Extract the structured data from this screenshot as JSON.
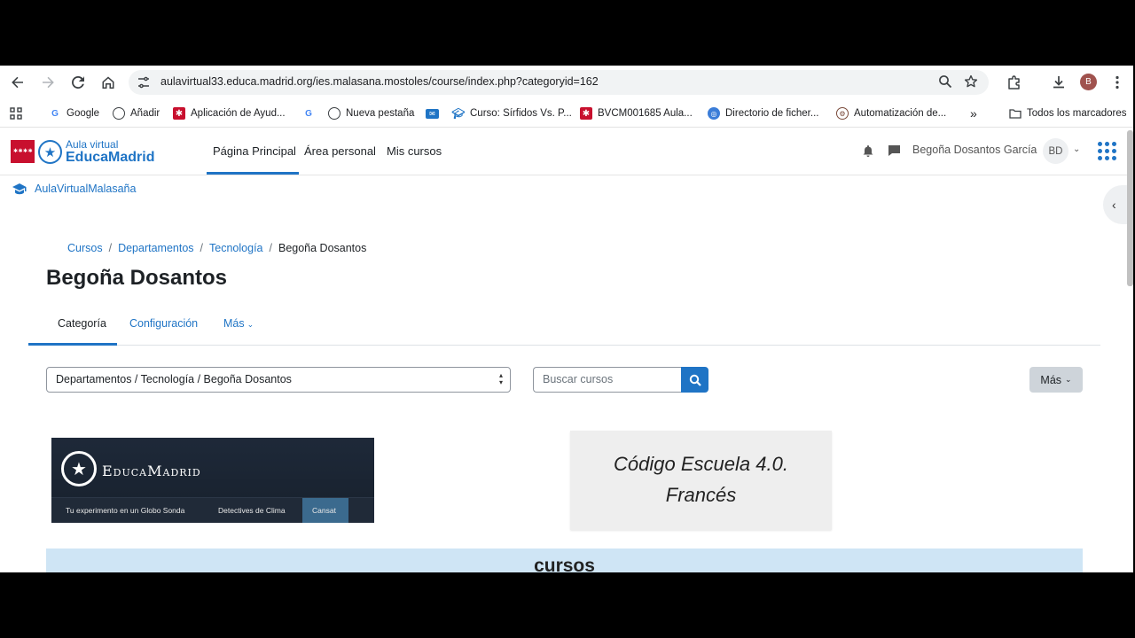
{
  "browser": {
    "url": "aulavirtual33.educa.madrid.org/ies.malasana.mostoles/course/index.php?categoryid=162",
    "profile_initial": "B",
    "bookmarks": [
      {
        "label": "Google",
        "icon": "google-icon"
      },
      {
        "label": "Añadir",
        "icon": "globe-icon"
      },
      {
        "label": "Aplicación de Ayud...",
        "icon": "comunidad-madrid-icon"
      },
      {
        "label": "",
        "icon": "google-icon"
      },
      {
        "label": "Nueva pestaña",
        "icon": "globe-icon"
      },
      {
        "label": "",
        "icon": "mail-icon"
      },
      {
        "label": "Curso: Sírfidos Vs. P...",
        "icon": "graduation-cap-icon"
      },
      {
        "label": "BVCM001685 Aula...",
        "icon": "comunidad-madrid-icon"
      },
      {
        "label": "Directorio de ficher...",
        "icon": "directory-icon"
      },
      {
        "label": "Automatización de...",
        "icon": "automation-icon"
      }
    ],
    "bookmarks_overflow": "»",
    "all_bookmarks": "Todos los marcadores"
  },
  "navbar": {
    "brand_line1": "Aula virtual",
    "brand_line2": "EducaMadrid",
    "links": [
      "Página Principal",
      "Área personal",
      "Mis cursos"
    ],
    "user_name": "Begoña Dosantos García",
    "user_initials": "BD"
  },
  "site": {
    "name": "AulaVirtualMalasaña"
  },
  "breadcrumb": [
    "Cursos",
    "Departamentos",
    "Tecnología",
    "Begoña Dosantos"
  ],
  "page": {
    "title": "Begoña Dosantos",
    "tabs": [
      "Categoría",
      "Configuración",
      "Más"
    ],
    "category_select_value": "Departamentos / Tecnología / Begoña Dosantos",
    "search_placeholder": "Buscar cursos",
    "more_button": "Más"
  },
  "banner": {
    "name": "EducaMadrid",
    "menu": [
      "Tu experimento en un Globo Sonda",
      "Detectives de Clima",
      "Cansat"
    ]
  },
  "course_card": {
    "line1": "Código Escuela 4.0.",
    "line2": "Francés"
  },
  "courses_section": {
    "title": "cursos"
  },
  "colors": {
    "brand": "#1f74c5",
    "flag_red": "#c8102e",
    "courses_band": "#cfe5f5"
  }
}
